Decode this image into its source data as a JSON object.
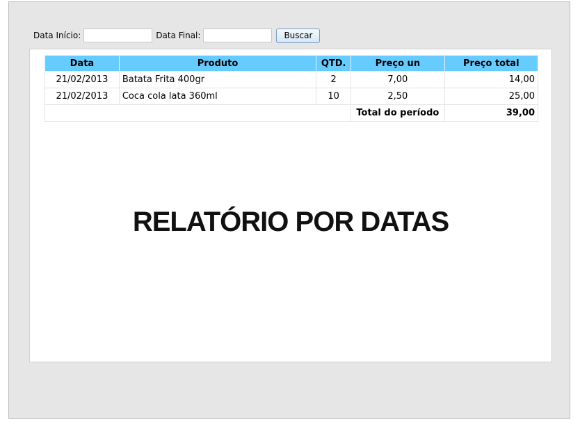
{
  "filters": {
    "start_label": "Data Início:",
    "start_value": "",
    "end_label": "Data Final:",
    "end_value": "",
    "search_button": "Buscar"
  },
  "table": {
    "headers": {
      "date": "Data",
      "product": "Produto",
      "qty": "QTD.",
      "unit_price": "Preço un",
      "total_price": "Preço total"
    },
    "rows": [
      {
        "date": "21/02/2013",
        "product": "Batata Frita 400gr",
        "qty": "2",
        "unit_price": "7,00",
        "total_price": "14,00"
      },
      {
        "date": "21/02/2013",
        "product": "Coca cola lata 360ml",
        "qty": "10",
        "unit_price": "2,50",
        "total_price": "25,00"
      }
    ],
    "total_label": "Total do período",
    "total_value": "39,00"
  },
  "headline": "RELATÓRIO POR DATAS",
  "colors": {
    "header_bg": "#66ccff",
    "frame_bg": "#e6e6e6",
    "button_border": "#7a9bbd"
  }
}
